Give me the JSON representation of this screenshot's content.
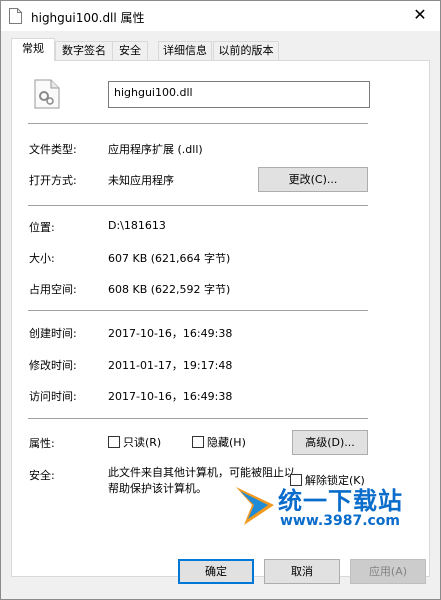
{
  "window": {
    "title": "highgui100.dll 属性",
    "close_glyph": "✕"
  },
  "tabs": [
    {
      "label": "常规",
      "active": true
    },
    {
      "label": "数字签名",
      "active": false
    },
    {
      "label": "安全",
      "active": false
    },
    {
      "label": "详细信息",
      "active": false
    },
    {
      "label": "以前的版本",
      "active": false
    }
  ],
  "general": {
    "file_name": "highgui100.dll",
    "file_type_label": "文件类型:",
    "file_type_value": "应用程序扩展 (.dll)",
    "open_with_label": "打开方式:",
    "open_with_value": "未知应用程序",
    "change_button": "更改(C)...",
    "location_label": "位置:",
    "location_value": "D:\\181613",
    "size_label": "大小:",
    "size_value": "607 KB (621,664 字节)",
    "size_on_disk_label": "占用空间:",
    "size_on_disk_value": "608 KB (622,592 字节)",
    "created_label": "创建时间:",
    "created_value": "2017-10-16，16:49:38",
    "modified_label": "修改时间:",
    "modified_value": "2011-01-17，19:17:48",
    "accessed_label": "访问时间:",
    "accessed_value": "2017-10-16，16:49:38",
    "attributes_label": "属性:",
    "readonly_label": "只读(R)",
    "hidden_label": "隐藏(H)",
    "advanced_button": "高级(D)...",
    "security_label": "安全:",
    "security_text": "此文件来自其他计算机，可能被阻止以帮助保护该计算机。",
    "unblock_label": "解除锁定(K)"
  },
  "watermark": {
    "brand": "统一下载站",
    "url": "www.3987.com"
  },
  "footer": {
    "ok": "确定",
    "cancel": "取消",
    "apply": "应用(A)"
  },
  "colors": {
    "accent": "#0078d7",
    "panel_bg": "#ffffff",
    "dialog_bg": "#f0f0f0",
    "watermark": "#0a6ccb"
  }
}
